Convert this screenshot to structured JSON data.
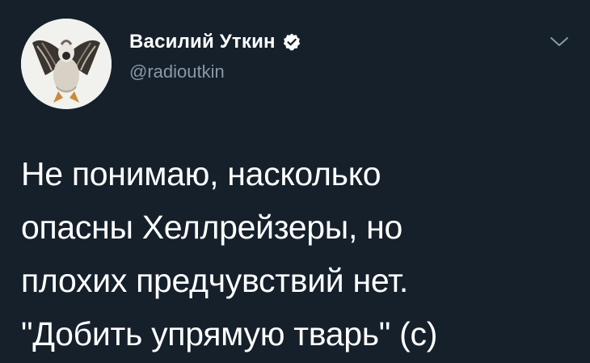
{
  "tweet": {
    "author": {
      "display_name": "Василий Уткин",
      "handle": "@radioutkin",
      "verified": true,
      "avatar_icon": "avatar-goose-photo"
    },
    "menu_icon": "chevron-down-icon",
    "text_lines": [
      "Не понимаю, насколько",
      "опасны Хеллрейзеры, но",
      "плохих предчувствий нет.",
      "\"Добить упрямую тварь\" (с)"
    ]
  },
  "colors": {
    "background": "#15202b",
    "primary_text": "#ffffff",
    "secondary_text": "#8899a6",
    "verified_badge": "#ffffff"
  }
}
